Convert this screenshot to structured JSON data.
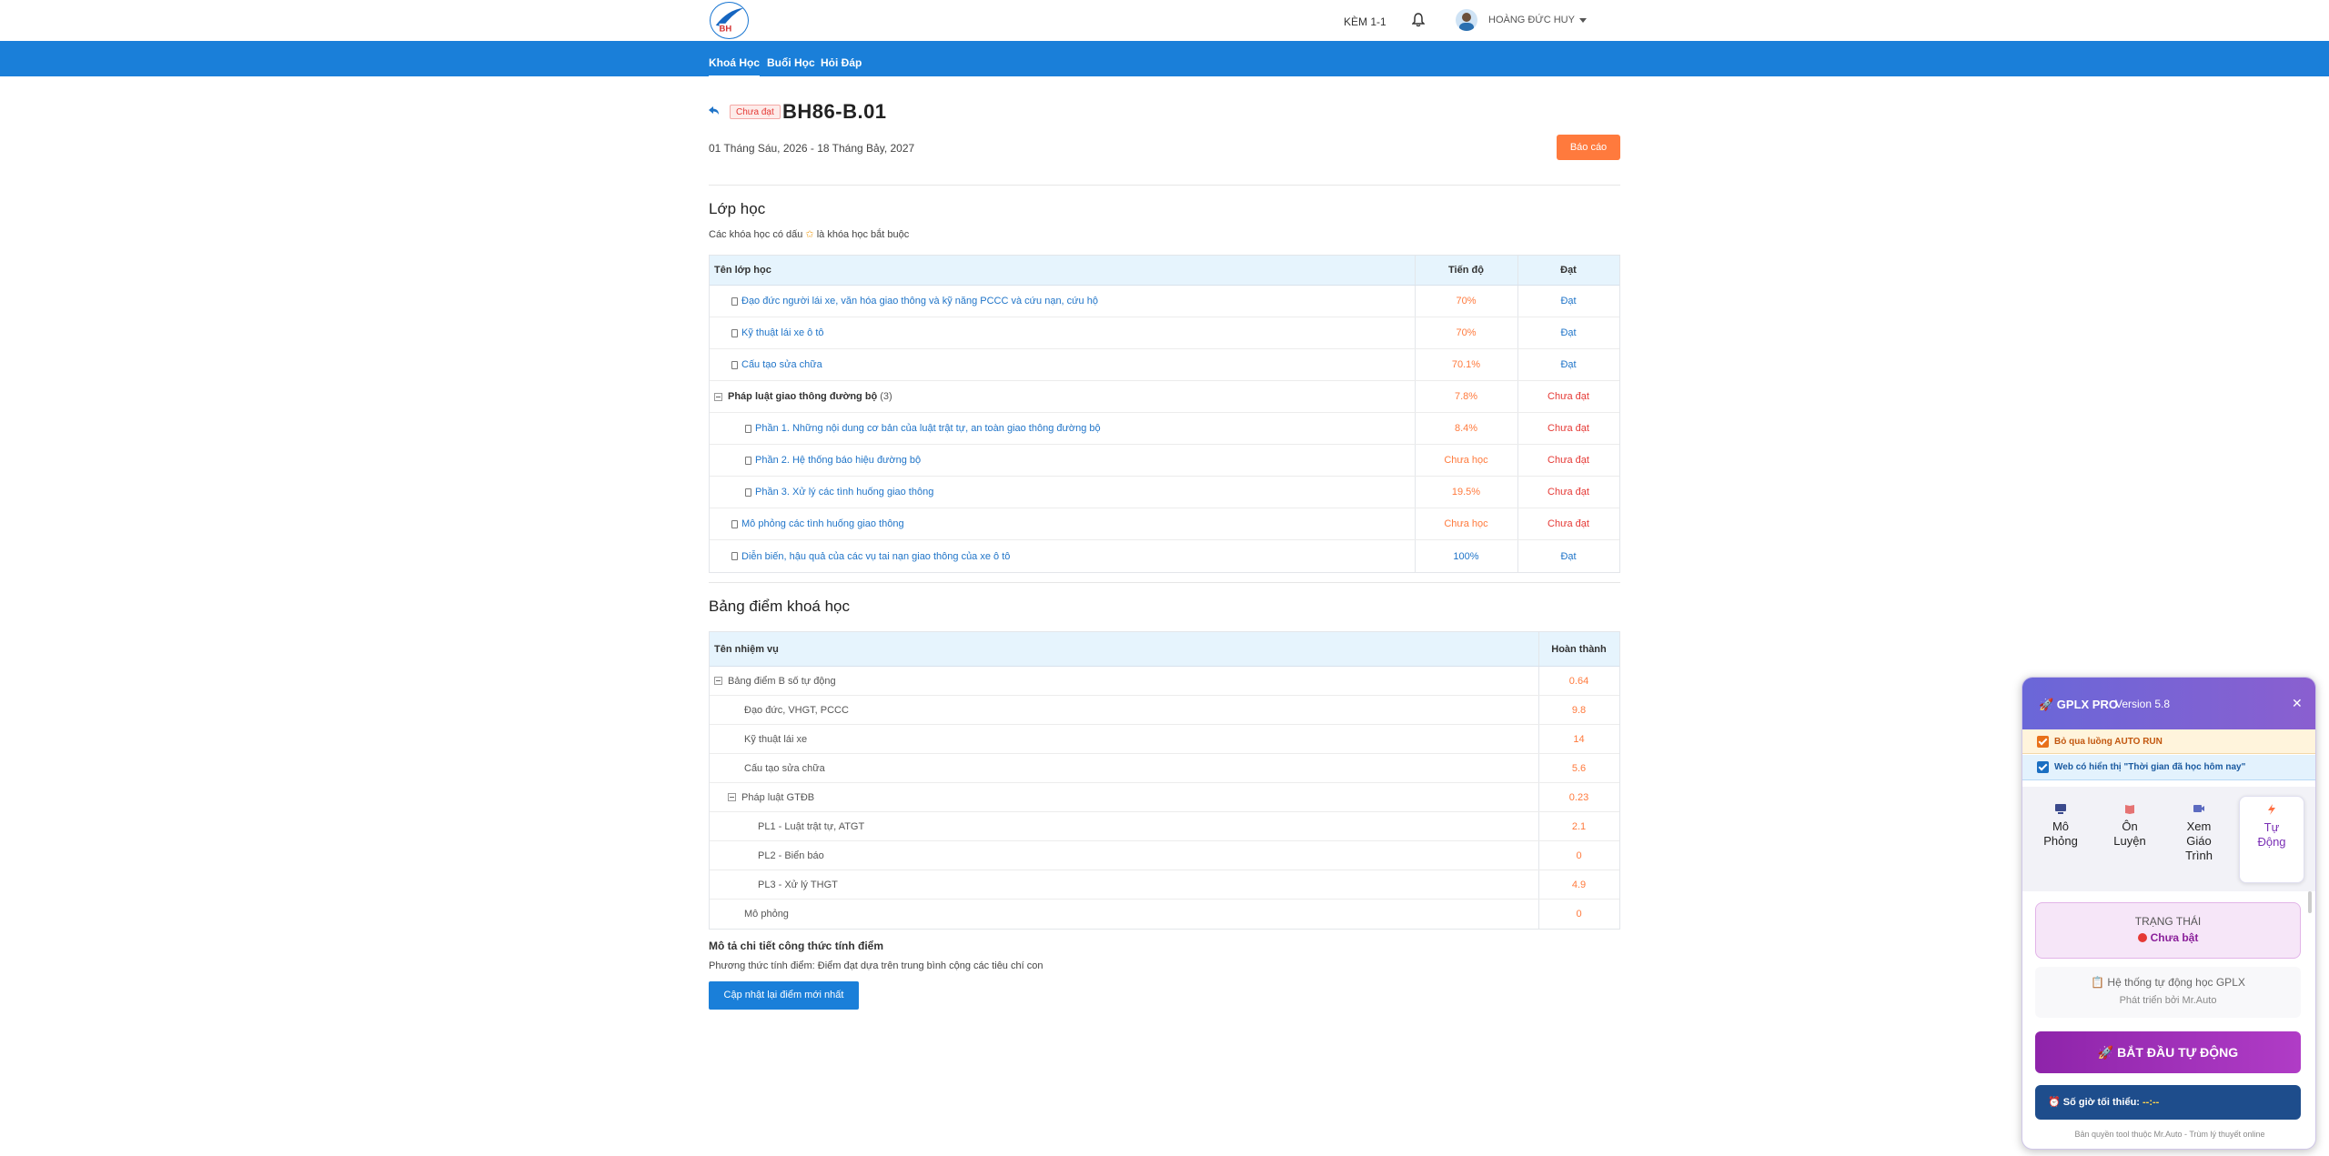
{
  "header": {
    "kem_label": "KÈM 1-1",
    "user_name": "HOÀNG ĐỨC HUY"
  },
  "nav": {
    "items": [
      {
        "label": "Khoá Học"
      },
      {
        "label": "Buổi Học"
      },
      {
        "label": "Hỏi Đáp"
      }
    ]
  },
  "course": {
    "status_badge": "Chưa đạt",
    "title": "BH86-B.01",
    "date_range": "01 Tháng Sáu, 2026 - 18 Tháng Bảy, 2027",
    "report_button": "Báo cáo"
  },
  "classes": {
    "title": "Lớp học",
    "note_before": "Các khóa học có dấu",
    "note_star": "✩",
    "note_after": "là khóa học bắt buộc",
    "headers": {
      "name": "Tên lớp học",
      "progress": "Tiến độ",
      "pass": "Đạt"
    },
    "rows": [
      {
        "name": "Đạo đức người lái xe, văn hóa giao thông và kỹ năng PCCC và cứu nạn, cứu hộ",
        "progress": "70%",
        "pass": "Đạt"
      },
      {
        "name": "Kỹ thuật lái xe ô tô",
        "progress": "70%",
        "pass": "Đạt"
      },
      {
        "name": "Cấu tạo sửa chữa",
        "progress": "70.1%",
        "pass": "Đạt"
      },
      {
        "name": "Pháp luật giao thông đường bộ",
        "count": "(3)",
        "progress": "7.8%",
        "pass": "Chưa đạt"
      },
      {
        "name": "Phần 1. Những nội dung cơ bản của luật trật tự, an toàn giao thông đường bộ",
        "progress": "8.4%",
        "pass": "Chưa đạt"
      },
      {
        "name": "Phần 2. Hệ thống báo hiệu đường bộ",
        "progress": "Chưa học",
        "pass": "Chưa đạt"
      },
      {
        "name": "Phần 3. Xử lý các tình huống giao thông",
        "progress": "19.5%",
        "pass": "Chưa đạt"
      },
      {
        "name": "Mô phỏng các tình huống giao thông",
        "progress": "Chưa học",
        "pass": "Chưa đạt"
      },
      {
        "name": "Diễn biến, hậu quả của các vụ tai nạn giao thông của xe ô tô",
        "progress": "100%",
        "pass": "Đạt"
      }
    ]
  },
  "scores": {
    "title": "Bảng điểm khoá học",
    "headers": {
      "task": "Tên nhiệm vụ",
      "done": "Hoàn thành"
    },
    "rows": [
      {
        "name": "Bảng điểm B số tự động",
        "value": "0.64"
      },
      {
        "name": "Đạo đức, VHGT, PCCC",
        "value": "9.8"
      },
      {
        "name": "Kỹ thuật lái xe",
        "value": "14"
      },
      {
        "name": "Cấu tạo sửa chữa",
        "value": "5.6"
      },
      {
        "name": "Pháp luật GTĐB",
        "value": "0.23"
      },
      {
        "name": "PL1 - Luật trật tự, ATGT",
        "value": "2.1"
      },
      {
        "name": "PL2 - Biển báo",
        "value": "0"
      },
      {
        "name": "PL3 - Xử lý THGT",
        "value": "4.9"
      },
      {
        "name": "Mô phỏng",
        "value": "0"
      }
    ],
    "formula_title": "Mô tả chi tiết công thức tính điểm",
    "formula_text": "Phương thức tính điểm: Điểm đạt dựa trên trung bình cộng các tiêu chí con",
    "update_button": "Cập nhật lại điểm mới nhất"
  },
  "panel": {
    "title": "🚀 GPLX PRO",
    "version": "Version 5.8",
    "close": "✕",
    "option1": "Bỏ qua luồng AUTO RUN",
    "option2": "Web có hiển thị \"Thời gian đã học hôm nay\"",
    "tabs": [
      {
        "line1": "Mô",
        "line2": "Phỏng",
        "icon": "monitor-icon"
      },
      {
        "line1": "Ôn",
        "line2": "Luyện",
        "icon": "book-icon"
      },
      {
        "line1": "Xem",
        "line2": "Giáo",
        "line3": "Trình",
        "icon": "video-icon"
      },
      {
        "line1": "Tự",
        "line2": "Động",
        "icon": "bolt-icon"
      }
    ],
    "status_label": "TRẠNG THÁI",
    "status_value": "Chưa bật",
    "system_line1": "📋 Hệ thống tự động học GPLX",
    "system_line2": "Phát triển bởi Mr.Auto",
    "start_button": "🚀  BẮT ĐẦU TỰ ĐỘNG",
    "hours_label": "⏰ Số giờ tối thiểu:",
    "hours_value": "--:--",
    "copyright": "Bản quyền tool thuộc Mr.Auto - Trùm lý thuyết online",
    "colors": {
      "accent": "#8e24aa",
      "header": "#6a67d8",
      "hours_bg": "#1e4d8c"
    }
  },
  "colors": {
    "nav": "#1a7fd9",
    "report": "#ff7a3d",
    "link": "#1f74c8",
    "fail": "#e53935"
  }
}
